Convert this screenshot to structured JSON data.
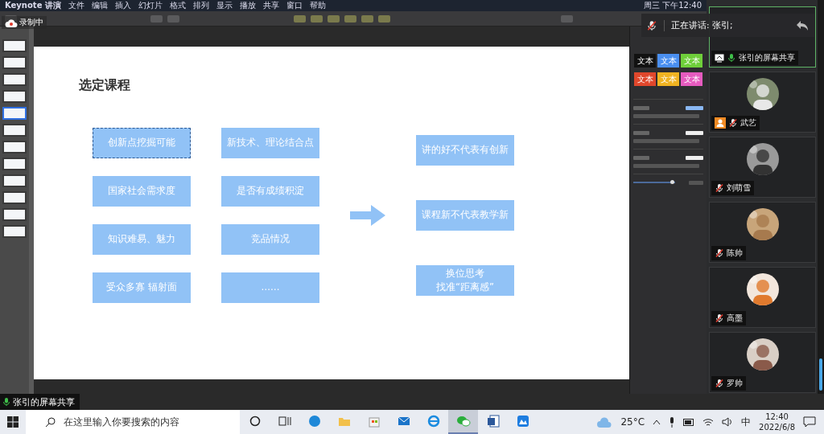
{
  "menubar": {
    "app": "Keynote 讲演",
    "menus": [
      "文件",
      "编辑",
      "插入",
      "幻灯片",
      "格式",
      "排列",
      "显示",
      "播放",
      "共享",
      "窗口",
      "帮助"
    ],
    "clock": "周三 下午12:40"
  },
  "recording": {
    "label": "录制中"
  },
  "thumbnails": [
    {
      "selected": false
    },
    {
      "selected": false
    },
    {
      "selected": false
    },
    {
      "selected": false
    },
    {
      "selected": true
    },
    {
      "selected": false
    },
    {
      "selected": false
    },
    {
      "selected": false
    },
    {
      "selected": false
    },
    {
      "selected": false
    },
    {
      "selected": false
    },
    {
      "selected": false
    }
  ],
  "slide": {
    "title": "选定课程",
    "column_1": [
      {
        "text": "创新点挖掘可能",
        "selected": true
      },
      {
        "text": "国家社会需求度",
        "selected": false
      },
      {
        "text": "知识难易、魅力",
        "selected": false
      },
      {
        "text": "受众多寡 辐射面",
        "selected": false
      }
    ],
    "column_2": [
      {
        "text": "新技术、理论结合点",
        "selected": false
      },
      {
        "text": "是否有成绩积淀",
        "selected": false
      },
      {
        "text": "竞品情况",
        "selected": false
      },
      {
        "text": "……",
        "selected": false
      }
    ],
    "column_3": [
      {
        "lines": [
          "讲的好不代表有创新"
        ]
      },
      {
        "lines": [
          "课程新不代表教学新"
        ]
      },
      {
        "lines": [
          "换位思考",
          "找准“距离感”"
        ]
      }
    ]
  },
  "inspector": {
    "swatches": [
      {
        "label": "文本",
        "color": "#111111"
      },
      {
        "label": "文本",
        "color": "#4a8ff0"
      },
      {
        "label": "文本",
        "color": "#6fcf3a"
      },
      {
        "label": "文本",
        "color": "#e0472c"
      },
      {
        "label": "文本",
        "color": "#f0b321"
      },
      {
        "label": "文本",
        "color": "#e65bbf"
      }
    ],
    "opacity_slider": {
      "level": 0.95
    }
  },
  "speaking": {
    "label": "正在讲话: 张引;"
  },
  "participants": [
    {
      "name": "张引的屏幕共享",
      "kind": "share",
      "muted": false,
      "host": false,
      "selected": true
    },
    {
      "name": "武艺",
      "kind": "avatar",
      "muted": true,
      "host": true,
      "selected": false
    },
    {
      "name": "刘萌雪",
      "kind": "avatar",
      "muted": true,
      "host": false,
      "selected": false
    },
    {
      "name": "陈帅",
      "kind": "avatar",
      "muted": true,
      "host": false,
      "selected": false
    },
    {
      "name": "高墨",
      "kind": "avatar",
      "muted": true,
      "host": false,
      "selected": false
    },
    {
      "name": "罗帅",
      "kind": "avatar",
      "muted": true,
      "host": false,
      "selected": false
    }
  ],
  "share_bar": {
    "label": "张引的屏幕共享",
    "muted": false
  },
  "taskbar": {
    "search": {
      "placeholder": "在这里输入你要搜索的内容"
    },
    "apps": [
      {
        "kind": "browser",
        "selected": false
      },
      {
        "kind": "folder",
        "selected": false
      },
      {
        "kind": "store",
        "selected": false
      },
      {
        "kind": "mail",
        "selected": false
      },
      {
        "kind": "globe",
        "selected": false
      },
      {
        "kind": "chat",
        "selected": true
      },
      {
        "kind": "document",
        "selected": false
      },
      {
        "kind": "app",
        "selected": false
      }
    ],
    "weather": "25°C",
    "ime": "中",
    "time": "12:40",
    "date": "2022/6/8"
  }
}
